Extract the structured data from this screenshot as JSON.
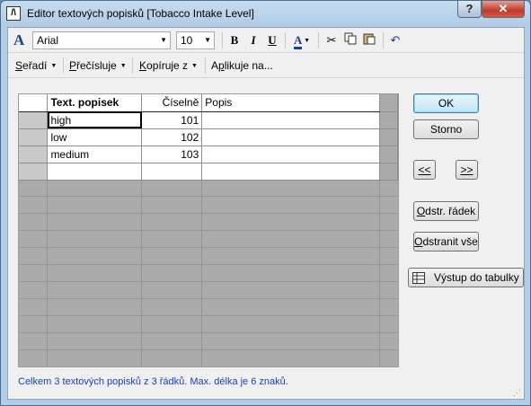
{
  "window": {
    "title": "Editor textových popisků [Tobacco Intake Level]",
    "help_label": "?",
    "close_label": "✕"
  },
  "toolbar": {
    "font_name": "Arial",
    "font_size": "10",
    "bold_label": "B",
    "italic_label": "I",
    "underline_label": "U",
    "font_color_label": "A",
    "font_color": "#1b3e97"
  },
  "menus": [
    {
      "pre": "",
      "key": "S",
      "post": "eřadí"
    },
    {
      "pre": "",
      "key": "P",
      "post": "řečísluje"
    },
    {
      "pre": "",
      "key": "K",
      "post": "opíruje z"
    },
    {
      "pre": "A",
      "key": "p",
      "post": "likuje na..."
    }
  ],
  "grid": {
    "headers": {
      "label": "Text. popisek",
      "numeric": "Číselně",
      "desc": "Popis"
    },
    "rows": [
      {
        "label": "high",
        "value": "101",
        "desc": ""
      },
      {
        "label": "low",
        "value": "102",
        "desc": ""
      },
      {
        "label": "medium",
        "value": "103",
        "desc": ""
      }
    ]
  },
  "buttons": {
    "ok": "OK",
    "cancel": "Storno",
    "prev": "<<",
    "next": ">>",
    "delete_row_key": "O",
    "delete_row_rest": "dstr. řádek",
    "delete_all_key": "O",
    "delete_all_rest": "dstranit vše",
    "export": "Výstup do tabulky"
  },
  "status": "Celkem 3 textových popisků z 3 řádků. Max. délka je 6 znaků."
}
